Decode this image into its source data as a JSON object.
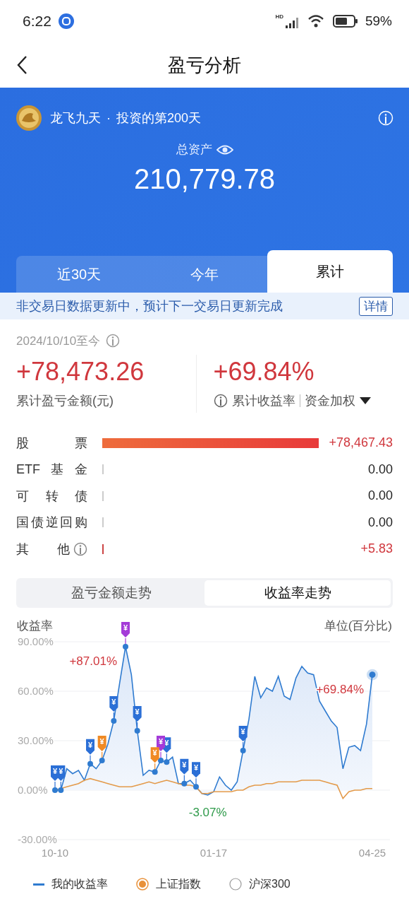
{
  "status_bar": {
    "time": "6:22",
    "network": "HD",
    "battery": "59%"
  },
  "nav": {
    "title": "盈亏分析"
  },
  "header": {
    "user": "龙飞九天",
    "separator": "·",
    "days": "投资的第200天",
    "asset_label": "总资产",
    "total_assets": "210,779.78"
  },
  "tabs": [
    {
      "label": "近30天",
      "selected": false
    },
    {
      "label": "今年",
      "selected": false
    },
    {
      "label": "累计",
      "selected": true
    }
  ],
  "notice": {
    "text": "非交易日数据更新中，预计下一交易日更新完成",
    "button": "详情"
  },
  "summary": {
    "period": "2024/10/10至今",
    "profit": "+78,473.26",
    "profit_label": "累计盈亏金额(元)",
    "rate": "+69.84%",
    "rate_label": "累计收益率",
    "weighting": "资金加权"
  },
  "breakdown": [
    {
      "label": "股票",
      "value": "+78,467.43",
      "info": false
    },
    {
      "label": "ETF基金",
      "value": "0.00",
      "info": false
    },
    {
      "label": "可转债",
      "value": "0.00",
      "info": false
    },
    {
      "label": "国债逆回购",
      "value": "0.00",
      "info": false
    },
    {
      "label": "其他",
      "value": "+5.83",
      "info": true
    }
  ],
  "chart_tabs": [
    {
      "label": "盈亏金额走势",
      "selected": false
    },
    {
      "label": "收益率走势",
      "selected": true
    }
  ],
  "chart": {
    "unit": "单位(百分比)",
    "chart_data": {
      "type": "line",
      "ylabel": "收益率",
      "categories": [
        "10-10",
        null,
        null,
        null,
        null,
        null,
        null,
        null,
        null,
        null,
        null,
        null,
        null,
        null,
        null,
        null,
        null,
        null,
        null,
        null,
        null,
        null,
        null,
        null,
        null,
        null,
        null,
        "01-17",
        null,
        null,
        null,
        null,
        null,
        null,
        null,
        null,
        null,
        null,
        null,
        null,
        null,
        null,
        null,
        null,
        null,
        null,
        null,
        null,
        null,
        null,
        null,
        null,
        null,
        null,
        "04-25"
      ],
      "ylim": [
        -30,
        90
      ],
      "grid": true,
      "yticks": [
        {
          "value": 90,
          "label": "90.00%"
        },
        {
          "value": 60,
          "label": "60.00%"
        },
        {
          "value": 30,
          "label": "30.00%"
        },
        {
          "value": 0,
          "label": "0.00%"
        },
        {
          "value": -30,
          "label": "-30.00%"
        }
      ],
      "series": [
        {
          "name": "我的收益率",
          "color": "#2f7bd0",
          "values": [
            0,
            0,
            13,
            10,
            12,
            6,
            16,
            13,
            18,
            28,
            42,
            65,
            87,
            70,
            36,
            9,
            12,
            11,
            18,
            17,
            20,
            4,
            4,
            6,
            2,
            -2,
            -3,
            -1,
            8,
            3,
            0,
            5,
            24,
            43,
            69,
            56,
            62,
            60,
            69,
            57,
            55,
            68,
            75,
            71,
            70,
            54,
            48,
            42,
            38,
            13,
            26,
            27,
            24,
            40,
            70
          ]
        },
        {
          "name": "上证指数",
          "color": "#e39a4a",
          "values": [
            0,
            1,
            2,
            3,
            4,
            6,
            7,
            6,
            5,
            4,
            3,
            2,
            2,
            2,
            3,
            4,
            5,
            4,
            5,
            6,
            5,
            4,
            3,
            3,
            2,
            -2,
            -2,
            -1,
            -1,
            -1,
            -1,
            0,
            0,
            2,
            3,
            3,
            4,
            4,
            5,
            5,
            5,
            5,
            6,
            6,
            6,
            6,
            5,
            4,
            3,
            -5,
            -1,
            0,
            0,
            1,
            1
          ]
        }
      ],
      "annotations": [
        "+87.01%",
        "-3.07%",
        "+69.84%"
      ]
    },
    "trade_flags": [
      {
        "text": "¥",
        "color": "#2b6fd6"
      },
      {
        "text": "¥",
        "color": "#2b6fd6"
      },
      {
        "text": "¥",
        "color": "#2b6fd6"
      },
      {
        "text": "¥",
        "color": "#f08a24"
      },
      {
        "text": "¥",
        "color": "#2b6fd6"
      },
      {
        "text": "¥",
        "color": "#a43bd8"
      },
      {
        "text": "¥",
        "color": "#2b6fd6"
      },
      {
        "text": "¥",
        "color": "#f08a24"
      },
      {
        "text": "¥",
        "color": "#a43bd8"
      },
      {
        "text": "¥",
        "color": "#2b6fd6"
      },
      {
        "text": "¥",
        "color": "#2b6fd6"
      },
      {
        "text": "¥",
        "color": "#2b6fd6"
      },
      {
        "text": "¥",
        "color": "#2b6fd6"
      }
    ]
  },
  "legend": [
    {
      "kind": "line"
    },
    {
      "kind": "radio",
      "selected": true
    },
    {
      "kind": "radio",
      "label": "沪深300",
      "selected": false
    }
  ]
}
